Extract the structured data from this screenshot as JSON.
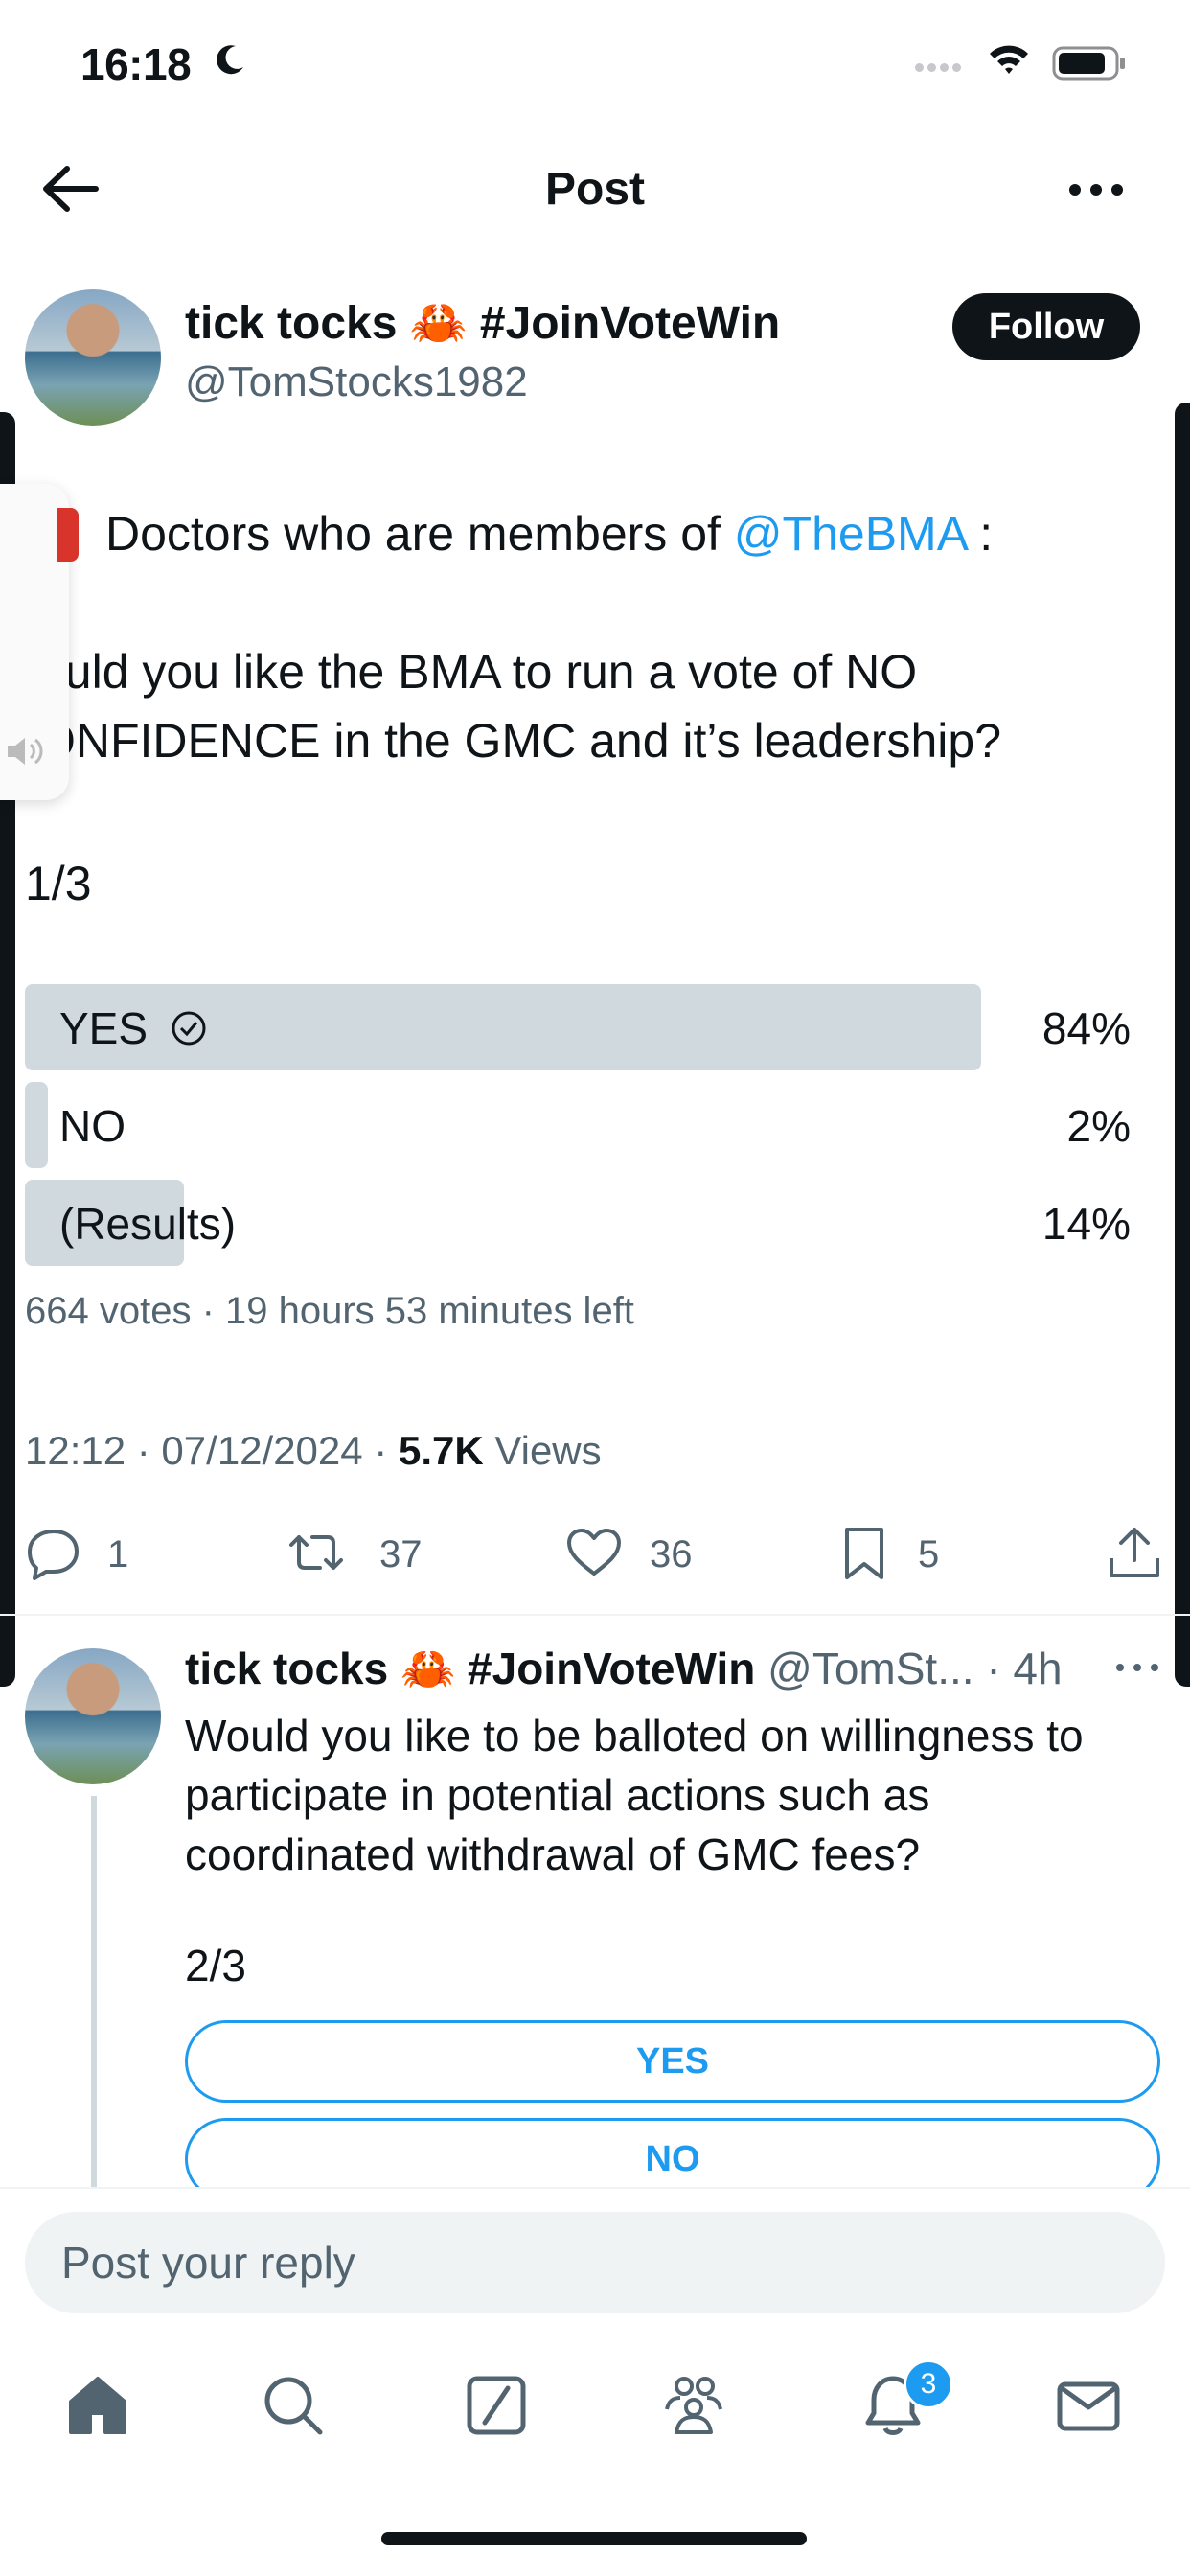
{
  "status_bar": {
    "time": "16:18"
  },
  "header": {
    "title": "Post"
  },
  "post": {
    "author_name": "tick tocks 🦀 #JoinVoteWin",
    "author_handle": "@TomStocks1982",
    "follow_label": "Follow",
    "text_line1_pre": "Doctors who are members of ",
    "text_line1_mention": "@TheBMA",
    "text_line1_post": " :",
    "text_line2": "ould you like the BMA to run a vote of NO",
    "text_line3": "ONFIDENCE in the GMC and it’s leadership?",
    "thread_count": "1/3",
    "poll": {
      "options": [
        {
          "label": "YES",
          "percent": "84%",
          "value": 84,
          "winner": true
        },
        {
          "label": "NO",
          "percent": "2%",
          "value": 2,
          "winner": false
        },
        {
          "label": "(Results)",
          "percent": "14%",
          "value": 14,
          "winner": false
        }
      ],
      "meta": "664 votes · 19 hours 53 minutes left"
    },
    "timestamp": "12:12 · 07/12/2024 · ",
    "views_count": "5.7K",
    "views_label": " Views",
    "actions": {
      "replies": "1",
      "reposts": "37",
      "likes": "36",
      "bookmarks": "5"
    }
  },
  "reply": {
    "author_name": "tick tocks 🦀 #JoinVoteWin",
    "handle_time": " @TomSt... · 4h",
    "text": "Would you like to be balloted on willingness to participate in potential actions such as coordinated withdrawal of GMC fees?",
    "thread_count": "2/3",
    "poll_options": [
      "YES",
      "NO"
    ]
  },
  "reply_input": {
    "placeholder": "Post your reply"
  },
  "tab_bar": {
    "items": [
      "home-icon",
      "search-icon",
      "grok-icon",
      "communities-icon",
      "notifications-icon",
      "messages-icon"
    ],
    "notifications_badge": "3"
  },
  "colors": {
    "accent": "#1d9bf0",
    "text": "#0f1419",
    "muted": "#536471",
    "poll_bar": "#cfd9de"
  }
}
